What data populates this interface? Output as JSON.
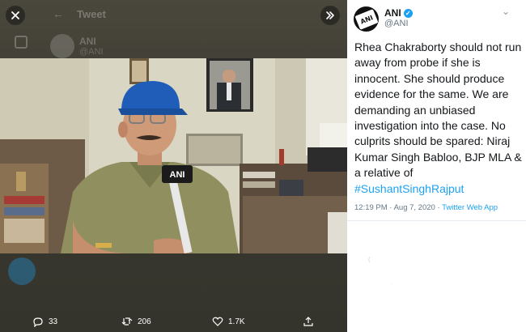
{
  "viewer": {
    "background_header_title": "Tweet",
    "background_author_name": "ANI",
    "background_author_handle": "@ANI",
    "photo_mic_label": "ANI",
    "close_icon": "close-icon",
    "expand_icon": "chevron-double-right-icon"
  },
  "actions": {
    "reply_count": "33",
    "retweet_count": "206",
    "like_count": "1.7K"
  },
  "tweet": {
    "author_name": "ANI",
    "author_handle": "@ANI",
    "avatar_text": "ANI",
    "text_main": "Rhea Chakraborty should not run away from probe if she is innocent. She should produce evidence for the same. We are demanding an unbiased investigation into the case. No culprits should be spared: Niraj Kumar Singh Babloo, BJP MLA & a relative of ",
    "hashtag": "#SushantSinghRajput",
    "time": "12:19 PM · Aug 7, 2020 · ",
    "source": "Twitter Web App"
  },
  "colors": {
    "accent": "#1da1f2",
    "text": "#14171a",
    "muted": "#657786",
    "viewer_bg": "#3c382e"
  }
}
